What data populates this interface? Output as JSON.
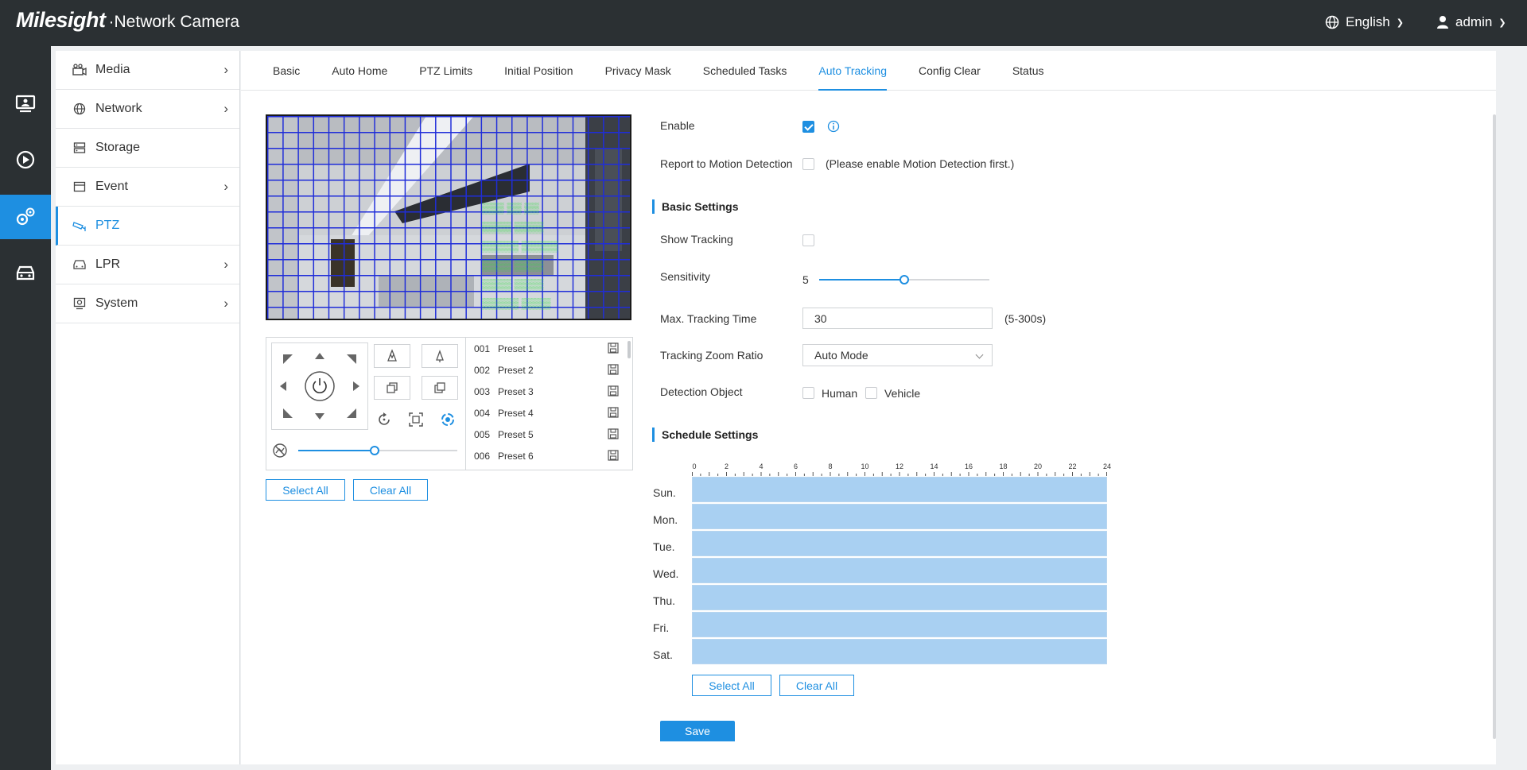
{
  "header": {
    "brand": "Milesight",
    "product": "·Network Camera",
    "language": "English",
    "user": "admin"
  },
  "rail": {
    "items": [
      {
        "icon": "live-view-icon"
      },
      {
        "icon": "playback-icon"
      },
      {
        "icon": "settings-icon",
        "active": true
      },
      {
        "icon": "vehicle-icon"
      }
    ]
  },
  "sidenav": {
    "items": [
      {
        "label": "Media",
        "icon": "media-icon",
        "chevron": true
      },
      {
        "label": "Network",
        "icon": "globe-icon",
        "chevron": true
      },
      {
        "label": "Storage",
        "icon": "storage-icon",
        "chevron": false
      },
      {
        "label": "Event",
        "icon": "event-icon",
        "chevron": true
      },
      {
        "label": "PTZ",
        "icon": "ptz-camera-icon",
        "chevron": false,
        "active": true
      },
      {
        "label": "LPR",
        "icon": "car-icon",
        "chevron": true
      },
      {
        "label": "System",
        "icon": "system-icon",
        "chevron": true
      }
    ]
  },
  "tabs": [
    "Basic",
    "Auto Home",
    "PTZ Limits",
    "Initial Position",
    "Privacy Mask",
    "Scheduled Tasks",
    "Auto Tracking",
    "Config Clear",
    "Status"
  ],
  "active_tab": "Auto Tracking",
  "ptz": {
    "zoom_level": 0.48,
    "presets": [
      {
        "num": "001",
        "name": "Preset 1"
      },
      {
        "num": "002",
        "name": "Preset 2"
      },
      {
        "num": "003",
        "name": "Preset 3"
      },
      {
        "num": "004",
        "name": "Preset 4"
      },
      {
        "num": "005",
        "name": "Preset 5"
      },
      {
        "num": "006",
        "name": "Preset 6"
      }
    ],
    "select_all": "Select All",
    "clear_all": "Clear All"
  },
  "form": {
    "enable_label": "Enable",
    "enable_checked": true,
    "report_label": "Report to Motion Detection",
    "report_note": "(Please enable Motion Detection first.)",
    "basic_settings": "Basic Settings",
    "show_tracking_label": "Show Tracking",
    "sensitivity_label": "Sensitivity",
    "sensitivity_value": "5",
    "sensitivity_fraction": 0.5,
    "max_time_label": "Max. Tracking Time",
    "max_time_value": "30",
    "max_time_range": "(5-300s)",
    "zoom_ratio_label": "Tracking Zoom Ratio",
    "zoom_ratio_value": "Auto Mode",
    "detection_object_label": "Detection Object",
    "human_label": "Human",
    "vehicle_label": "Vehicle",
    "schedule_settings": "Schedule Settings"
  },
  "schedule": {
    "hours": [
      "0",
      "2",
      "4",
      "6",
      "8",
      "10",
      "12",
      "14",
      "16",
      "18",
      "20",
      "22",
      "24"
    ],
    "days": [
      "Sun.",
      "Mon.",
      "Tue.",
      "Wed.",
      "Thu.",
      "Fri.",
      "Sat."
    ],
    "select_all": "Select All",
    "clear_all": "Clear All"
  },
  "save_label": "Save",
  "colors": {
    "accent": "#1e8fe1",
    "topbar": "#2b3033",
    "schedule_fill": "#a9d0f2",
    "grid": "#1f2dd9",
    "osd": "#29e23a"
  }
}
